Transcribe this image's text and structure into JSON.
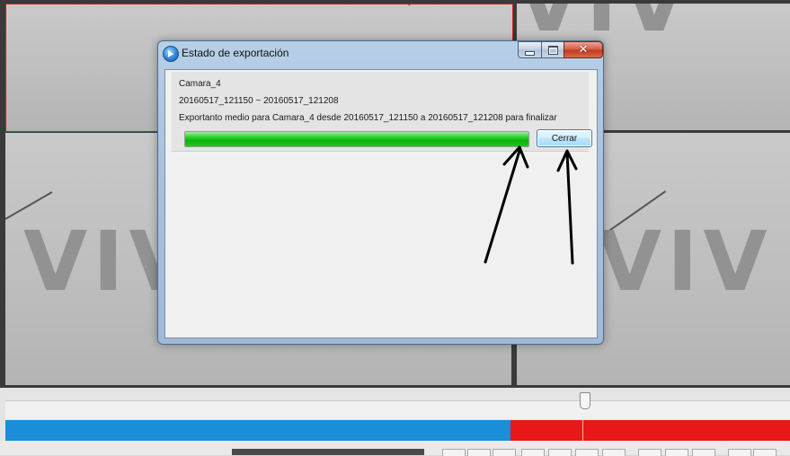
{
  "dialog": {
    "title": "Estado de exportación",
    "camera_name": "Camara_4",
    "time_range": "20160517_121150 ~ 20160517_121208",
    "message": "Exportanto medio para Camara_4 desde 20160517_121150 a 20160517_121208 para finalizar",
    "progress_percent": 100,
    "close_button_label": "Cerrar"
  },
  "background": {
    "watermark_text": "VIV",
    "colors": {
      "timeline_recorded": "#1a8ed8",
      "timeline_event": "#e81818",
      "progress_fill": "#0bb30b",
      "cell_border_selected": "#d32020"
    }
  },
  "icons": {
    "app": "app-play-icon",
    "minimize": "minimize-icon",
    "maximize": "maximize-icon",
    "close": "close-icon"
  }
}
